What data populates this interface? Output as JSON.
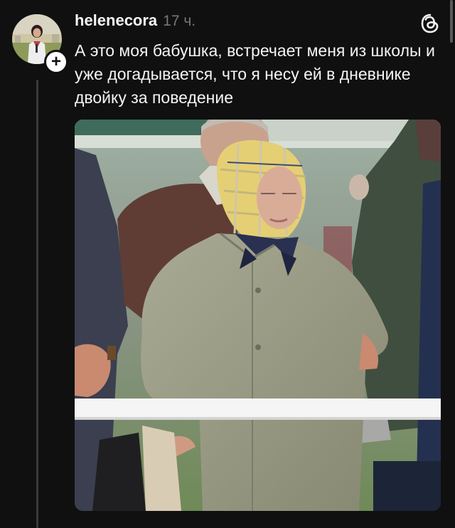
{
  "post": {
    "author": {
      "username": "helenecora",
      "avatar_icon": "profile-photo",
      "follow_badge": "+"
    },
    "timestamp": "17 ч.",
    "app_icon": "threads-icon",
    "text": "А это моя бабушка, встречает меня из школы и уже догадывается, что я несу ей в дневнике двойку за поведение",
    "media": {
      "type": "photo",
      "subject": "elderly woman in headscarf and beige coat, hands on hips"
    }
  },
  "colors": {
    "background": "#101010",
    "text_primary": "#f3f5f7",
    "text_secondary": "#777777",
    "thread_line": "#3a3a3a"
  }
}
